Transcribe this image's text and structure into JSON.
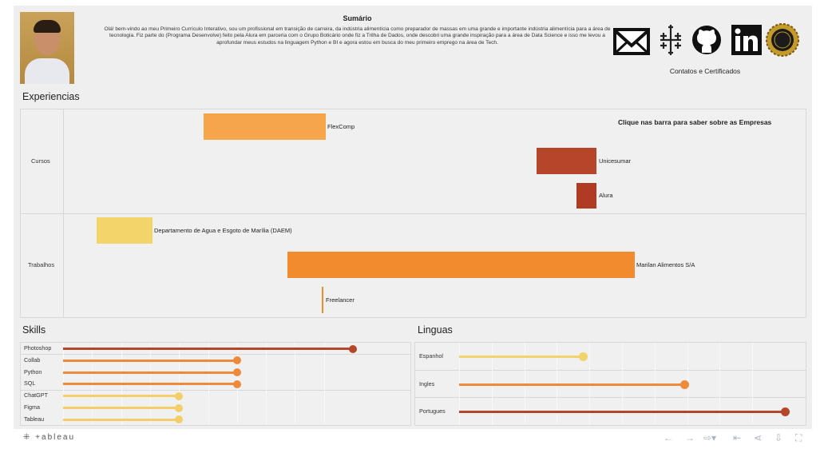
{
  "header": {
    "summary_title": "Sumário",
    "summary_text": "Olá! bem-vindo ao meu Primeiro Currículo Interativo, sou um profissional em transição de carreira, da indústria alimentícia como preparador de massas em uma grande e importante indústria alimentícia para a área de tecnologia. Fiz parte do  (Programa Desenvolve) feito pela Alura em parceria com o Grupo Boticário onde fiz a Trilha de Dados, onde descobri uma grande inspiração para a área de Data Science e isso me levou a aprofundar meus estudos na linguagem Python e BI e agora estou em busca do meu primeiro emprego na área de Tech.",
    "contacts_label": "Contatos e Certificados",
    "icons": [
      "mail-icon",
      "tableau-icon",
      "github-icon",
      "linkedin-icon",
      "certificate-seal-icon"
    ]
  },
  "experiencias": {
    "title": "Experiencias",
    "hint": "Clique nas barra para saber sobre as Empresas",
    "groups": [
      {
        "label": "Cursos",
        "bars": [
          {
            "label": "FlexComp",
            "color": "#f6a54a"
          },
          {
            "label": "Unicesumar",
            "color": "#b5462a"
          },
          {
            "label": "Alura",
            "color": "#b03a22"
          }
        ]
      },
      {
        "label": "Trabalhos",
        "bars": [
          {
            "label": "Departamento de Agua e Esgoto de Marília (DAEM)",
            "color": "#f3d46a"
          },
          {
            "label": "Marilan Alimentos S/A",
            "color": "#f28a2e"
          },
          {
            "label": "Freelancer",
            "color": "#f28a2e"
          }
        ]
      }
    ]
  },
  "skills": {
    "title": "Skills",
    "items": [
      {
        "label": "Photoshop",
        "value": 1.0,
        "color": "#b5462a"
      },
      {
        "label": "Collab",
        "value": 0.6,
        "color": "#ee8a3c"
      },
      {
        "label": "Python",
        "value": 0.6,
        "color": "#ee8a3c"
      },
      {
        "label": "SQL",
        "value": 0.6,
        "color": "#ee8a3c"
      },
      {
        "label": "ChatGPT",
        "value": 0.4,
        "color": "#f3ce6a"
      },
      {
        "label": "Figma",
        "value": 0.4,
        "color": "#f3ce6a"
      },
      {
        "label": "Tableau",
        "value": 0.4,
        "color": "#f3ce6a"
      }
    ]
  },
  "linguas": {
    "title": "Linguas",
    "items": [
      {
        "label": "Espanhol",
        "value": 0.38,
        "color": "#f3d46a"
      },
      {
        "label": "Ingles",
        "value": 0.69,
        "color": "#ee8a3c"
      },
      {
        "label": "Portugues",
        "value": 1.0,
        "color": "#b5462a"
      }
    ]
  },
  "footer": {
    "logo": "+ableau",
    "controls": [
      "undo-icon",
      "redo-icon",
      "revert-icon",
      "reset-icon",
      "share-icon",
      "download-icon",
      "fullscreen-icon"
    ]
  }
}
